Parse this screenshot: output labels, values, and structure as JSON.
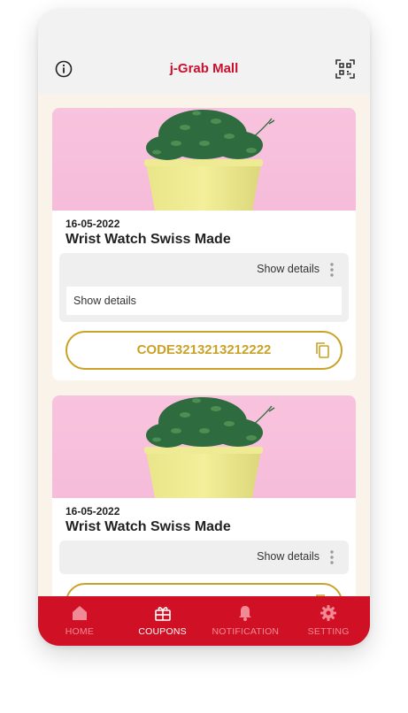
{
  "header": {
    "title": "j-Grab Mall",
    "left_icon": "info-icon",
    "right_icon": "qr-code-icon"
  },
  "coupons": [
    {
      "date": "16-05-2022",
      "name": "Wrist Watch Swiss Made",
      "details_toggle_label": "Show details",
      "details_text": "Show details",
      "expanded": true,
      "code": "CODE3213213212222",
      "image": "potted-plant-photo"
    },
    {
      "date": "16-05-2022",
      "name": "Wrist Watch Swiss Made",
      "details_toggle_label": "Show details",
      "expanded": false,
      "image": "potted-plant-photo"
    }
  ],
  "tabs": [
    {
      "label": "HOME",
      "icon": "home-icon",
      "active": false
    },
    {
      "label": "COUPONS",
      "icon": "coupon-icon",
      "active": true
    },
    {
      "label": "NOTIFICATION",
      "icon": "bell-icon",
      "active": false
    },
    {
      "label": "SETTING",
      "icon": "gear-icon",
      "active": false
    }
  ],
  "colors": {
    "brand_red": "#d01024",
    "title_red": "#c8102e",
    "gold": "#c9a227",
    "background": "#faf3e9",
    "header_bg": "#f2f2f2"
  }
}
